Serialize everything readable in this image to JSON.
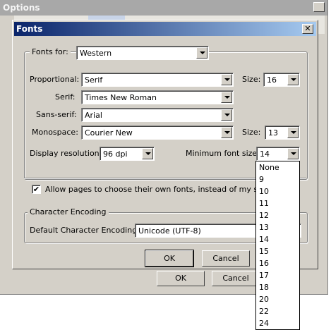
{
  "background_window": {
    "title": "Options",
    "ok_label": "OK",
    "cancel_label": "Cancel"
  },
  "dialog": {
    "title": "Fonts",
    "fonts_for": {
      "label": "Fonts for:",
      "value": "Western"
    },
    "proportional": {
      "label": "Proportional:",
      "value": "Serif",
      "size_label": "Size:",
      "size_value": "16"
    },
    "serif": {
      "label": "Serif:",
      "value": "Times New Roman"
    },
    "sans_serif": {
      "label": "Sans-serif:",
      "value": "Arial"
    },
    "monospace": {
      "label": "Monospace:",
      "value": "Courier New",
      "size_label": "Size:",
      "size_value": "13"
    },
    "display_resolution": {
      "label": "Display resolution:",
      "value": "96 dpi"
    },
    "minimum_font_size": {
      "label": "Minimum font size:",
      "value": "14"
    },
    "allow_pages": {
      "label": "Allow pages to choose their own fonts, instead of my selection",
      "checked": true
    },
    "character_encoding": {
      "group_label": "Character Encoding",
      "label": "Default Character Encoding:",
      "value": "Unicode (UTF-8)"
    },
    "ok_label": "OK",
    "cancel_label": "Cancel"
  },
  "min_font_size_dropdown": {
    "options": [
      "None",
      "9",
      "10",
      "11",
      "12",
      "13",
      "14",
      "15",
      "16",
      "17",
      "18",
      "20",
      "22",
      "24"
    ]
  }
}
